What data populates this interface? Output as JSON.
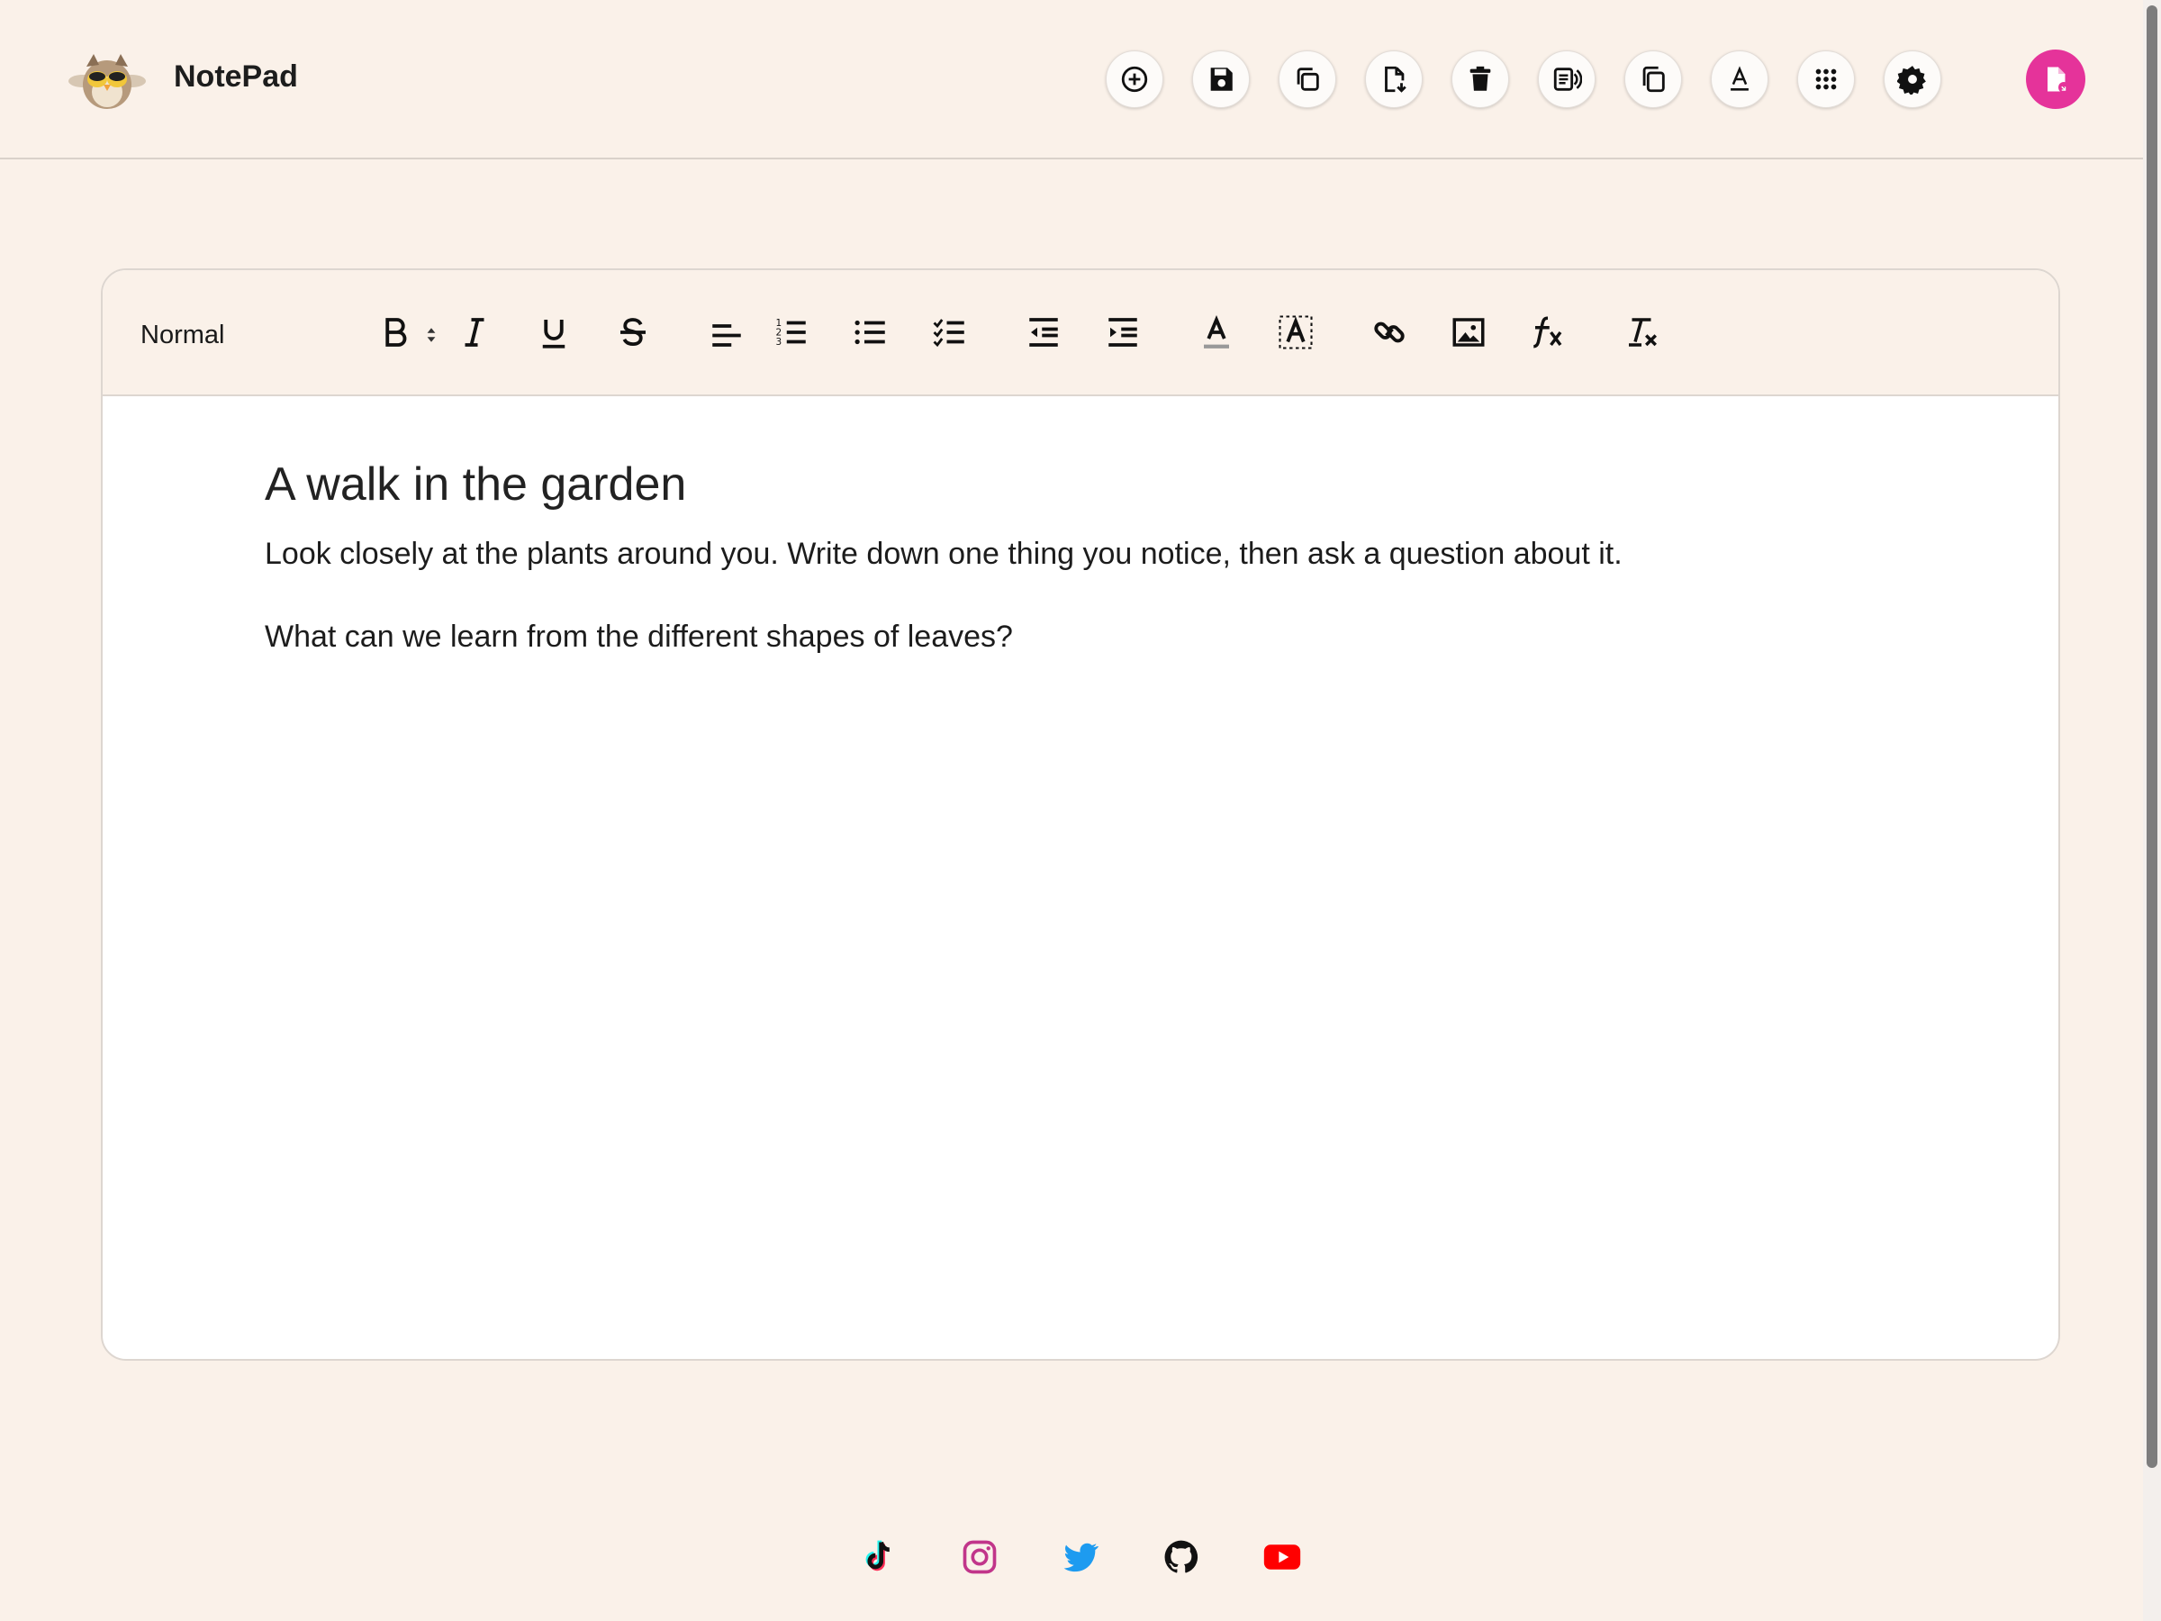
{
  "header": {
    "app_title": "NotePad",
    "logo_icon": "owl-logo-icon",
    "buttons": [
      {
        "name": "new-note-button",
        "icon": "plus-circle-icon"
      },
      {
        "name": "save-button",
        "icon": "floppy-disk-icon"
      },
      {
        "name": "copy-button",
        "icon": "copy-icon"
      },
      {
        "name": "download-button",
        "icon": "file-download-icon"
      },
      {
        "name": "delete-button",
        "icon": "trash-icon"
      },
      {
        "name": "read-aloud-button",
        "icon": "speaker-document-icon"
      },
      {
        "name": "duplicate-button",
        "icon": "duplicate-icon"
      },
      {
        "name": "font-button",
        "icon": "font-icon"
      },
      {
        "name": "apps-button",
        "icon": "grid-dots-icon"
      },
      {
        "name": "settings-button",
        "icon": "gear-icon"
      }
    ],
    "profile_icon": "document-badge-icon",
    "profile_color": "#e5339a"
  },
  "toolbar": {
    "format_value": "Normal",
    "tools": [
      "bold",
      "italic",
      "underline",
      "strikethrough",
      "align-left",
      "ordered-list",
      "bullet-list",
      "check-list",
      "outdent",
      "indent",
      "text-color",
      "highlight",
      "link",
      "image",
      "formula",
      "clear-format"
    ]
  },
  "document": {
    "title": "A walk in the garden",
    "paragraphs": [
      "Look closely at the plants around you. Write down one thing you notice, then ask a question about it.",
      "What can we learn from the different shapes of leaves?"
    ]
  },
  "footer": {
    "social": [
      {
        "name": "tiktok-icon",
        "color": "#111111"
      },
      {
        "name": "instagram-icon",
        "color": "#c1358a"
      },
      {
        "name": "twitter-icon",
        "color": "#1d9bf0"
      },
      {
        "name": "github-icon",
        "color": "#111111"
      },
      {
        "name": "youtube-icon",
        "color": "#ff0000"
      }
    ]
  },
  "colors": {
    "background": "#faf1e9",
    "accent": "#e5339a"
  }
}
